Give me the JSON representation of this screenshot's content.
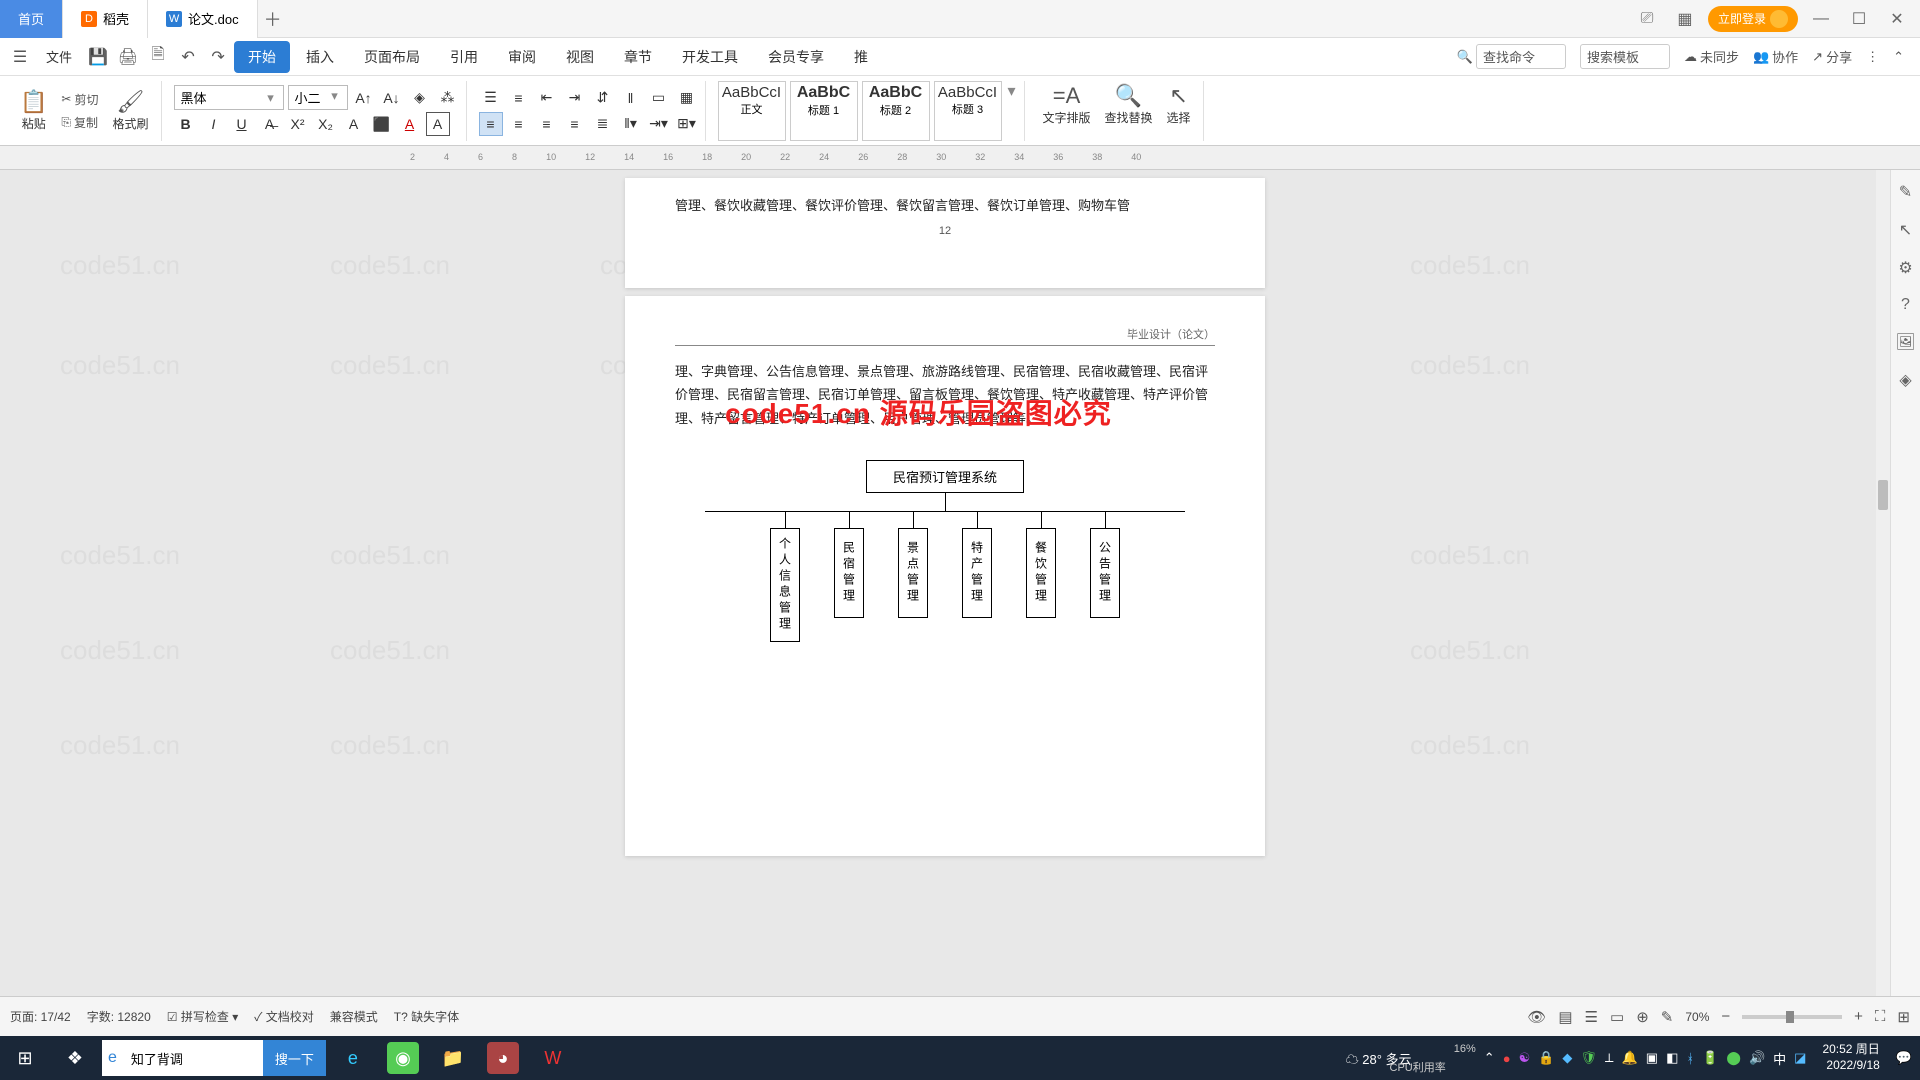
{
  "tabs": {
    "home": "首页",
    "docell": "稻壳",
    "doc": "论文.doc"
  },
  "login": "立即登录",
  "file_menu": "文件",
  "menus": [
    "插入",
    "页面布局",
    "引用",
    "审阅",
    "视图",
    "章节",
    "开发工具",
    "会员专享",
    "推"
  ],
  "menu_start": "开始",
  "search_placeholder": "查找命令",
  "search_template": "搜索模板",
  "sync": "未同步",
  "coop": "协作",
  "share": "分享",
  "clipboard": {
    "paste": "粘贴",
    "cut": "剪切",
    "copy": "复制",
    "fmtpaint": "格式刷"
  },
  "font": {
    "name": "黑体",
    "size": "小二"
  },
  "styles": {
    "preview": "AaBbCcI",
    "heading_preview": "AaBbC",
    "body": "正文",
    "h1": "标题 1",
    "h2": "标题 2",
    "h3": "标题 3"
  },
  "bigbtn": {
    "layout": "文字排版",
    "find": "查找替换",
    "select": "选择"
  },
  "ruler_marks": [
    "2",
    "4",
    "6",
    "8",
    "10",
    "12",
    "14",
    "16",
    "18",
    "20",
    "22",
    "24",
    "26",
    "28",
    "30",
    "32",
    "34",
    "36",
    "38",
    "40"
  ],
  "page1": {
    "text": "管理、餐饮收藏管理、餐饮评价管理、餐饮留言管理、餐饮订单管理、购物车管",
    "num": "12"
  },
  "page2": {
    "header": "毕业设计（论文）",
    "para": "理、字典管理、公告信息管理、景点管理、旅游路线管理、民宿管理、民宿收藏管理、民宿评价管理、民宿留言管理、民宿订单管理、留言板管理、餐饮管理、特产收藏管理、特产评价管理、特产留言管理、特产订单管理、用户管理、管理员管理等。"
  },
  "watermark_red": "code51.cn 源码乐园盗图必究",
  "watermark_grey": "code51.cn",
  "org": {
    "root": "民宿预订管理系统",
    "children": [
      "个人信息管理",
      "民宿管理",
      "景点管理",
      "特产管理",
      "餐饮管理",
      "公告管理"
    ]
  },
  "status": {
    "page": "页面: 17/42",
    "words": "字数: 12820",
    "spell": "拼写检查",
    "proof": "文档校对",
    "compat": "兼容模式",
    "missing": "缺失字体",
    "zoom": "70%",
    "cpu": "CPU利用率",
    "cpu_pct": "16%"
  },
  "taskbar": {
    "search_val": "知了背调",
    "search_btn": "搜一下",
    "weather": "28° 多云",
    "time": "20:52 周日",
    "date": "2022/9/18"
  }
}
